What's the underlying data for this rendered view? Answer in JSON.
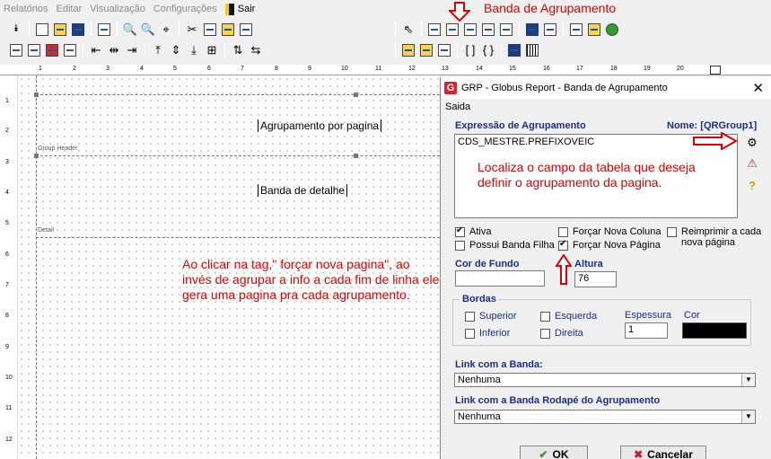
{
  "menu": {
    "items": [
      "Relatórios",
      "Editar",
      "Visualização",
      "Configurações"
    ],
    "sair_label": "Sair"
  },
  "annotations": {
    "top": "Banda de Agrupamento",
    "memo": "Localiza o campo da tabela que deseja definir o agrupamento da pagina.",
    "canvas": "Ao clicar na tag,\" forçar nova pagina\", ao invés de agrupar a info a cada fim de linha ele gera uma pagina pra cada agrupamento.",
    "color": "#e00000"
  },
  "ruler": {
    "h": [
      "1",
      "2",
      "3",
      "4",
      "5",
      "6",
      "7",
      "8",
      "9",
      "10",
      "11",
      "12",
      "13",
      "14",
      "15",
      "16",
      "17",
      "18",
      "19",
      "20"
    ],
    "v": [
      "1",
      "2",
      "3",
      "4",
      "5",
      "6",
      "7",
      "8",
      "9",
      "10",
      "11",
      "12"
    ]
  },
  "report": {
    "group_header_label": "Group Header",
    "group_header_text": "Agrupamento por pagina",
    "detail_label": "Detail",
    "detail_text": "Banda de detalhe"
  },
  "dialog": {
    "title": "GRP - Globus Report - Banda de Agrupamento",
    "close": "✕",
    "menu": "Saida",
    "expression_label": "Expressão de Agrupamento",
    "name_label": "Nome: [QRGroup1]",
    "expression_value": "CDS_MESTRE.PREFIXOVEIC",
    "ativa": "Ativa",
    "possui_banda_filha": "Possui Banda Filha",
    "forcar_nova_coluna": "Forçar Nova Coluna",
    "forcar_nova_pagina": "Forçar Nova Página",
    "reimprimir": "Reimprimir a cada nova página",
    "cor_de_fundo": "Cor de Fundo",
    "altura_label": "Altura",
    "altura_value": "76",
    "bordas": "Bordas",
    "superior": "Superior",
    "inferior": "Inferior",
    "esquerda": "Esquerda",
    "direita": "Direita",
    "espessura_label": "Espessura",
    "espessura_value": "1",
    "cor_label": "Cor",
    "link_banda_label": "Link com a Banda:",
    "link_banda_value": "Nenhuma",
    "link_rodape_label": "Link com a Banda Rodapé do Agrupamento",
    "link_rodape_value": "Nenhuma",
    "ok": "OK",
    "cancelar": "Cancelar"
  },
  "checks": {
    "ativa": true,
    "possui_banda_filha": false,
    "forcar_nova_coluna": false,
    "forcar_nova_pagina": true,
    "reimprimir": false,
    "superior": false,
    "inferior": false,
    "esquerda": false,
    "direita": false
  }
}
